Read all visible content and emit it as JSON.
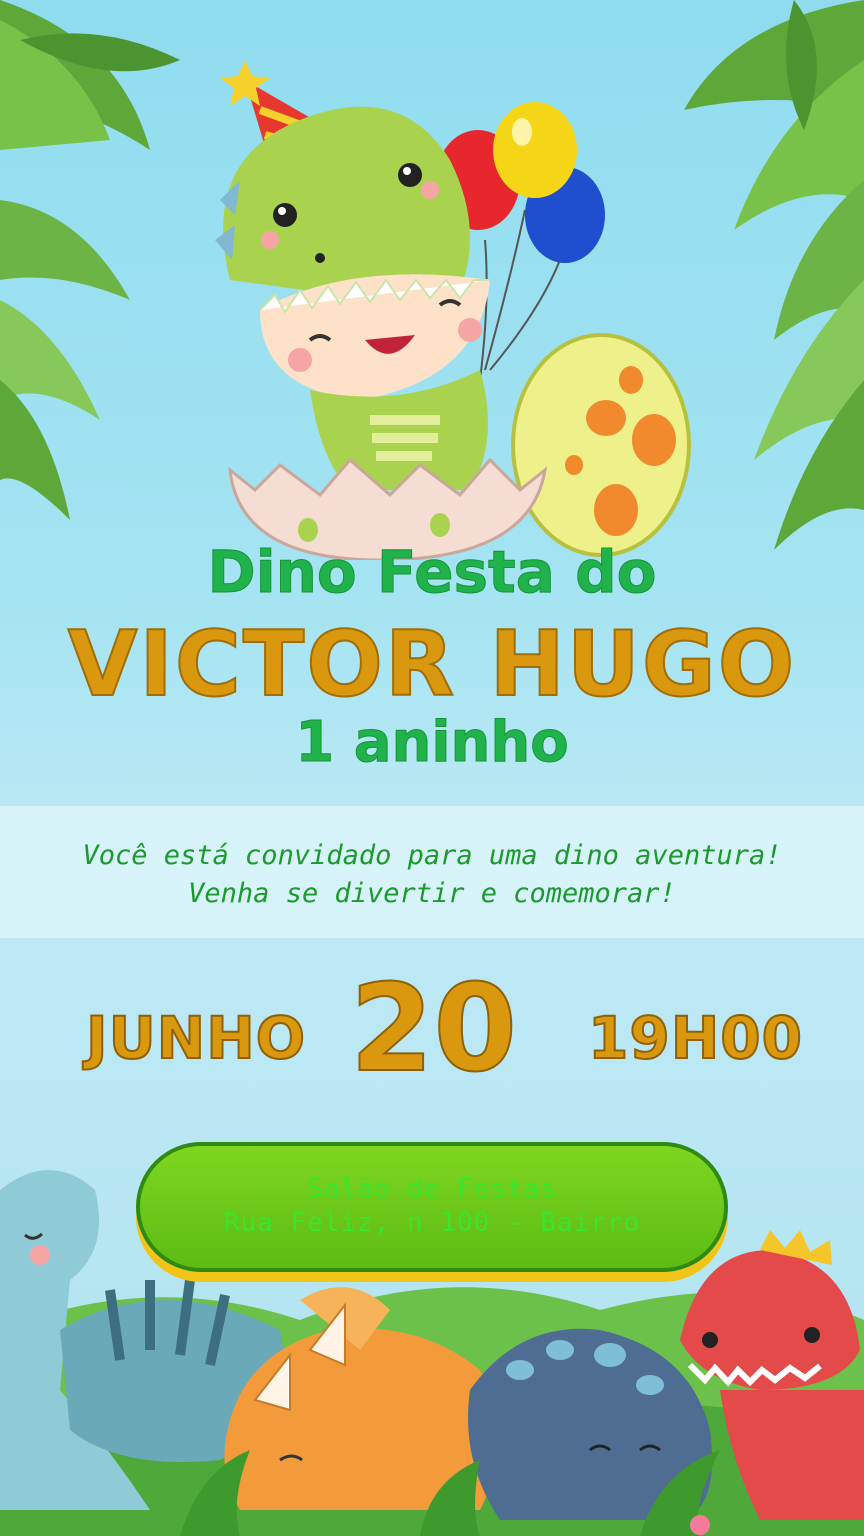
{
  "title": {
    "line1": "Dino Festa do",
    "name": "VICTOR HUGO",
    "age": "1 aninho"
  },
  "message": {
    "line1": "Você está convidado para uma dino aventura!",
    "line2": "Venha se divertir e comemorar!"
  },
  "date": {
    "month": "JUNHO",
    "day": "20",
    "time": "19H00"
  },
  "venue": {
    "name": "Salão de Festas",
    "address": "Rua Feliz, n 100 - Bairro"
  },
  "colors": {
    "title_green": "#21b34b",
    "name_gold": "#d9980d",
    "message_green": "#1d9a2e",
    "venue_button": "#5dbb14",
    "venue_text": "#39e52e",
    "sky": "#a6e4f2"
  },
  "illustrations": [
    "palm-leaves",
    "baby-dino-costume",
    "party-hat",
    "balloons",
    "spotted-egg",
    "dinosaur-group",
    "jungle-bushes"
  ]
}
